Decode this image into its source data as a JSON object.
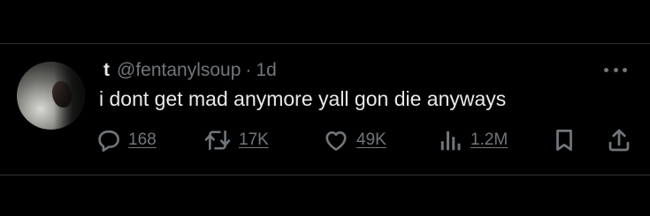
{
  "tweet": {
    "display_name": "t",
    "handle": "@fentanylsoup",
    "separator": "·",
    "timestamp": "1d",
    "text": "i dont get mad anymore yall gon die anyways"
  },
  "actions": {
    "replies": "168",
    "reposts": "17K",
    "likes": "49K",
    "views": "1.2M"
  },
  "icons": [
    "reply-icon",
    "repost-icon",
    "like-icon",
    "views-icon",
    "bookmark-icon",
    "share-icon",
    "more-icon"
  ],
  "colors": {
    "background": "#000000",
    "text": "#e7e9ea",
    "muted": "#71767b",
    "divider": "#2f3336"
  }
}
